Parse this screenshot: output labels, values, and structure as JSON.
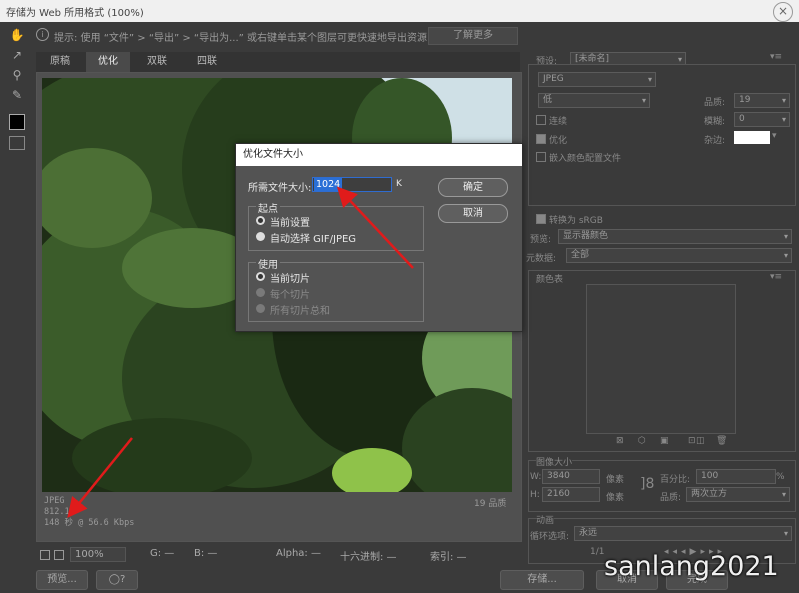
{
  "window": {
    "title": "存储为 Web 所用格式 (100%)"
  },
  "hint": {
    "text": "提示: 使用 “文件” > “导出” > “导出为...” 或右键单击某个图层可更快速地导出资源",
    "learn_more": "了解更多"
  },
  "tabs": [
    {
      "label": "原稿"
    },
    {
      "label": "优化"
    },
    {
      "label": "双联"
    },
    {
      "label": "四联"
    }
  ],
  "image_info": {
    "format": "JPEG",
    "size": "812.1K",
    "time": "148 秒 @ 56.6 Kbps",
    "quality": "19 品质"
  },
  "status": {
    "zoom": "100%",
    "g": "G: —",
    "b": "B: —",
    "alpha": "Alpha: —",
    "hex": "十六进制: —",
    "index": "索引: —"
  },
  "footer": {
    "preview": "预览...",
    "save": "存储...",
    "cancel": "取消",
    "done": "完成"
  },
  "right": {
    "preset_label": "预设:",
    "preset_value": "[未命名]",
    "format": "JPEG",
    "quality_level": "低",
    "quality_label": "品质:",
    "quality_value": "19",
    "progressive": "连续",
    "blur_label": "模糊:",
    "blur_value": "0",
    "optimized": "优化",
    "matte_label": "杂边:",
    "embed_profile": "嵌入颜色配置文件",
    "convert_srgb": "转换为 sRGB",
    "preview_label": "预览:",
    "preview_value": "显示器颜色",
    "metadata_label": "元数据:",
    "metadata_value": "全部",
    "color_table": "颜色表",
    "image_size": "图像大小",
    "w_label": "W:",
    "w_value": "3840",
    "w_unit": "像素",
    "h_label": "H:",
    "h_value": "2160",
    "h_unit": "像素",
    "percent_label": "百分比:",
    "percent_value": "100",
    "percent_unit": "%",
    "quality2_label": "品质:",
    "quality2_value": "两次立方",
    "animation": "动画",
    "loop_label": "循环选项:",
    "loop_value": "永远",
    "frame": "1/1"
  },
  "dialog": {
    "title": "优化文件大小",
    "desired_label": "所需文件大小:",
    "desired_value": "1024",
    "unit": "K",
    "ok": "确定",
    "cancel": "取消",
    "start_group": "起点",
    "start_opt1": "当前设置",
    "start_opt2": "自动选择 GIF/JPEG",
    "use_group": "使用",
    "use_opt1": "当前切片",
    "use_opt2": "每个切片",
    "use_opt3": "所有切片总和"
  },
  "watermark": "sanlang2021",
  "colors": {
    "annotation_arrow": "#e01b1b",
    "highlight": "#2a6fd6"
  }
}
